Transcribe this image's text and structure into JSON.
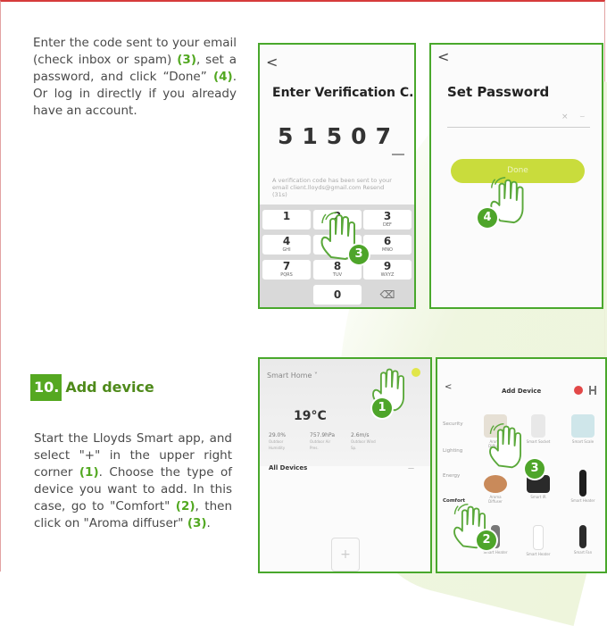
{
  "intro": {
    "text_before_3": "Enter the code sent to your email (check inbox or spam) ",
    "marker_3": "(3)",
    "text_before_4": ", set a password, and click “Done” ",
    "marker_4": "(4)",
    "text_after": ". Or log in directly if you already have an account."
  },
  "verify_screen": {
    "back": "<",
    "title": "Enter Verification C...",
    "code": "51507",
    "hint": "A verification code has been sent to your email client.lloyds@gmail.com Resend (31s)",
    "keys": [
      {
        "digit": "1",
        "letters": ""
      },
      {
        "digit": "2",
        "letters": "ABC"
      },
      {
        "digit": "3",
        "letters": "DEF"
      },
      {
        "digit": "4",
        "letters": "GHI"
      },
      {
        "digit": "5",
        "letters": "JKL"
      },
      {
        "digit": "6",
        "letters": "MNO"
      },
      {
        "digit": "7",
        "letters": "PQRS"
      },
      {
        "digit": "8",
        "letters": "TUV"
      },
      {
        "digit": "9",
        "letters": "WXYZ"
      },
      {
        "digit": "0",
        "letters": ""
      }
    ],
    "delete_key": "⌫",
    "badge": "3"
  },
  "password_screen": {
    "back": "<",
    "title": "Set Password",
    "field_icons": "×  ⌣",
    "done": "Done",
    "badge": "4"
  },
  "step": {
    "number": "10.",
    "title": "Add device"
  },
  "add_device_text": {
    "t1": "Start the Lloyds Smart app, and select \"+\" in the upper right corner ",
    "m1": "(1)",
    "t2": ". Choose the type of device you want to add. In this case, go to \"Comfort\" ",
    "m2": "(2)",
    "t3": ", then click on \"Aroma diffuser\" ",
    "m3": "(3)",
    "t4": "."
  },
  "home_screen": {
    "home_label": "Smart Home ˅",
    "temperature": "19°C",
    "weather": [
      {
        "value": "29.0%",
        "label": "Outdoor Humidity"
      },
      {
        "value": "757.9hPa",
        "label": "Outdoor Air Pres."
      },
      {
        "value": "2.6m/s",
        "label": "Outdoor Wind Sp."
      }
    ],
    "all_devices": "All Devices",
    "more": "—",
    "empty_icon": "+",
    "badge": "1"
  },
  "add_device_screen": {
    "back": "<",
    "title": "Add Device",
    "categories": [
      "Security",
      "Lighting",
      "Energy",
      "Comfort"
    ],
    "devices": [
      {
        "label": "Aroma Diffuser",
        "color": "#e6e0d5"
      },
      {
        "label": "Smart Socket",
        "color": "#e8e8e8"
      },
      {
        "label": "Smart Scale",
        "color": "#cfe6ea"
      },
      {
        "label": "Aroma Diffuser",
        "color": "#c98a5a"
      },
      {
        "label": "Smart IR",
        "color": "#2a2a2a"
      },
      {
        "label": "Smart Heater",
        "color": "#1e1e1e"
      },
      {
        "label": "Smart Heater",
        "color": "#777777"
      },
      {
        "label": "Smart Heater",
        "color": "#ffffff"
      },
      {
        "label": "Smart Fan",
        "color": "#2b2b2b"
      }
    ],
    "badge_2": "2",
    "badge_3": "3"
  },
  "colors": {
    "accent_green": "#52a821",
    "frame_red": "#d63b3b",
    "done_button": "#c9dc3c"
  }
}
